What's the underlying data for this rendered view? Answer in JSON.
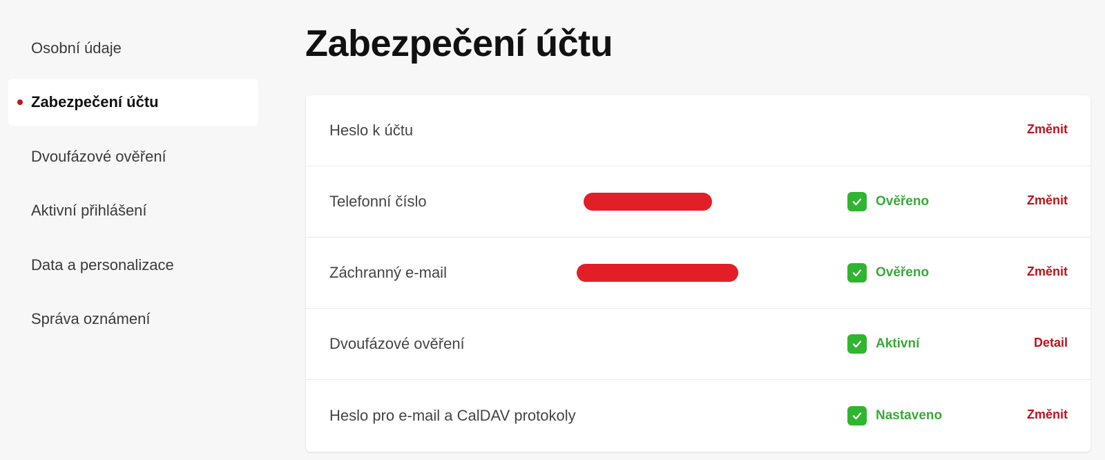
{
  "sidebar": {
    "items": [
      {
        "label": "Osobní údaje",
        "active": false
      },
      {
        "label": "Zabezpečení účtu",
        "active": true
      },
      {
        "label": "Dvoufázové ověření",
        "active": false
      },
      {
        "label": "Aktivní přihlášení",
        "active": false
      },
      {
        "label": "Data a personalizace",
        "active": false
      },
      {
        "label": "Správa oznámení",
        "active": false
      }
    ]
  },
  "page": {
    "title": "Zabezpečení účtu"
  },
  "security": {
    "rows": [
      {
        "label": "Heslo k účtu",
        "status": "",
        "action": "Změnit"
      },
      {
        "label": "Telefonní číslo",
        "status": "Ověřeno",
        "action": "Změnit"
      },
      {
        "label": "Záchranný e-mail",
        "status": "Ověřeno",
        "action": "Změnit"
      },
      {
        "label": "Dvoufázové ověření",
        "status": "Aktivní",
        "action": "Detail"
      },
      {
        "label": "Heslo pro e-mail a CalDAV protokoly",
        "status": "Nastaveno",
        "action": "Změnit"
      }
    ]
  },
  "colors": {
    "accent": "#c4141c",
    "status_green": "#3aa83a",
    "check_green": "#2fb52f",
    "redaction_red": "#e21f26",
    "background": "#f7f7f7"
  },
  "icons": {
    "status": "check-icon",
    "active_marker": "active-dot-icon"
  }
}
